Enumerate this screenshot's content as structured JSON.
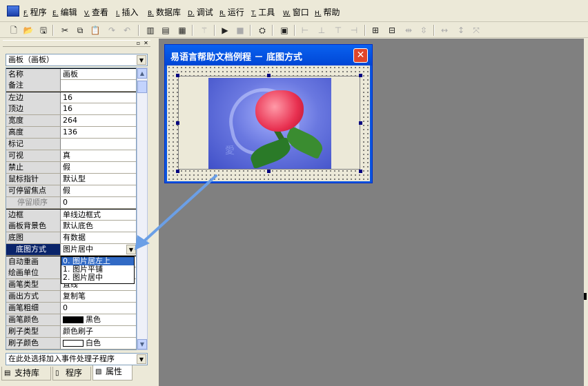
{
  "menu": [
    {
      "key": "F.",
      "label": "程序"
    },
    {
      "key": "E.",
      "label": "编辑"
    },
    {
      "key": "V.",
      "label": "查看"
    },
    {
      "key": "I.",
      "label": "插入"
    },
    {
      "key": "B.",
      "label": "数据库"
    },
    {
      "key": "D.",
      "label": "调试"
    },
    {
      "key": "R.",
      "label": "运行"
    },
    {
      "key": "T.",
      "label": "工具"
    },
    {
      "key": "W.",
      "label": "窗口"
    },
    {
      "key": "H.",
      "label": "帮助"
    }
  ],
  "panel": {
    "object_selector": "画板（画板）",
    "event_selector": "在此处选择加入事件处理子程序"
  },
  "properties": [
    {
      "name": "名称",
      "value": "画板"
    },
    {
      "name": "备注",
      "value": ""
    },
    {
      "name": "左边",
      "value": "16"
    },
    {
      "name": "顶边",
      "value": "16"
    },
    {
      "name": "宽度",
      "value": "264"
    },
    {
      "name": "高度",
      "value": "136"
    },
    {
      "name": "标记",
      "value": ""
    },
    {
      "name": "可视",
      "value": "真"
    },
    {
      "name": "禁止",
      "value": "假"
    },
    {
      "name": "鼠标指针",
      "value": "默认型"
    },
    {
      "name": "可停留焦点",
      "value": "假"
    },
    {
      "name": "停留顺序",
      "value": "0"
    },
    {
      "name": "边框",
      "value": "单线边框式"
    },
    {
      "name": "画板背景色",
      "value": "默认底色"
    },
    {
      "name": "底图",
      "value": "有数据"
    },
    {
      "name": "底图方式",
      "value": "图片居中"
    },
    {
      "name": "自动重画",
      "value": ""
    },
    {
      "name": "绘画单位",
      "value": ""
    },
    {
      "name": "画笔类型",
      "value": "直线"
    },
    {
      "name": "画出方式",
      "value": "复制笔"
    },
    {
      "name": "画笔粗细",
      "value": "0"
    },
    {
      "name": "画笔颜色",
      "value": "黑色"
    },
    {
      "name": "刷子类型",
      "value": "颜色刷子"
    },
    {
      "name": "刷子颜色",
      "value": "白色"
    }
  ],
  "dropdown_options": [
    "0. 图片居左上",
    "1. 图片平铺",
    "2. 图片居中"
  ],
  "tabs": [
    "支持库",
    "程序",
    "属性"
  ],
  "window": {
    "title": "易语言帮助文档例程 － 底图方式",
    "close": "✕"
  },
  "photo_char": "愛",
  "colors": {
    "selection": "#0a246a",
    "highlight": "#316ac5",
    "title_bar": "#0054e3"
  }
}
